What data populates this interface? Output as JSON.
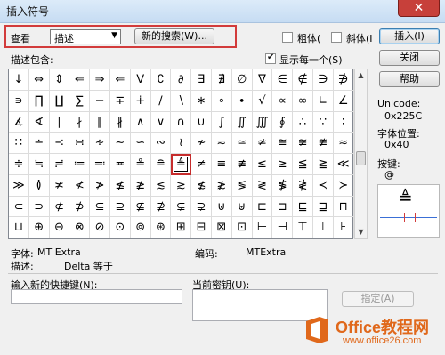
{
  "window": {
    "title": "插入符号",
    "close_glyph": "✕"
  },
  "toolbar": {
    "view_label": "查看",
    "view_value": "描述",
    "new_search_button": "新的搜索(W)...",
    "bold_label": "粗体(",
    "italic_label": "斜体(I",
    "insert_button": "插入(I)"
  },
  "list": {
    "description_label": "描述包含:",
    "show_each_label": "显示每一个(S)",
    "show_each_checked": true,
    "close_button": "关闭",
    "help_button": "帮助"
  },
  "symbols": [
    "↓",
    "⇔",
    "⇕",
    "⇐",
    "⇒",
    "⇐",
    "∀",
    "∁",
    "∂",
    "∃",
    "∄",
    "∅",
    "∇",
    "∈",
    "∉",
    "∋",
    "∌",
    "∍",
    "∏",
    "∐",
    "∑",
    "−",
    "∓",
    "∔",
    "∕",
    "∖",
    "∗",
    "∘",
    "∙",
    "√",
    "∝",
    "∞",
    "∟",
    "∠",
    "∡",
    "∢",
    "∣",
    "∤",
    "∥",
    "∦",
    "∧",
    "∨",
    "∩",
    "∪",
    "∫",
    "∬",
    "∭",
    "∮",
    "∴",
    "∵",
    "∶",
    "∷",
    "∸",
    "∹",
    "∺",
    "∻",
    "∼",
    "∽",
    "∾",
    "≀",
    "≁",
    "≂",
    "≃",
    "≄",
    "≅",
    "≆",
    "≇",
    "≈",
    "≑",
    "≒",
    "≓",
    "≔",
    "≕",
    "≖",
    "≗",
    "≘",
    "≜",
    "≠",
    "≡",
    "≢",
    "≤",
    "≥",
    "≦",
    "≧",
    "≪",
    "≫",
    "≬",
    "≭",
    "≮",
    "≯",
    "≰",
    "≱",
    "≲",
    "≳",
    "≴",
    "≵",
    "≶",
    "≷",
    "≸",
    "≹",
    "≺",
    "≻",
    "⊂",
    "⊃",
    "⊄",
    "⊅",
    "⊆",
    "⊇",
    "⊈",
    "⊉",
    "⊊",
    "⊋",
    "⊍",
    "⊎",
    "⊏",
    "⊐",
    "⊑",
    "⊒",
    "⊓",
    "⊔",
    "⊕",
    "⊖",
    "⊗",
    "⊘",
    "⊙",
    "⊚",
    "⊛",
    "⊞",
    "⊟",
    "⊠",
    "⊡",
    "⊢",
    "⊣",
    "⊤",
    "⊥",
    "⊦"
  ],
  "selected_index": 76,
  "info": {
    "unicode_label": "Unicode:",
    "unicode_value": "0x225C",
    "font_pos_label": "字体位置:",
    "font_pos_value": "0x40",
    "key_label": "按键:",
    "key_value": "@",
    "preview_symbol": "≜"
  },
  "details": {
    "font_label": "字体:",
    "font_value": "MT Extra",
    "encoding_label": "编码:",
    "encoding_value": "MTExtra",
    "desc_label": "描述:",
    "desc_value": "Delta 等于"
  },
  "shortcut": {
    "new_shortcut_label": "输入新的快捷键(N):",
    "current_key_label": "当前密钥(U):",
    "assign_button": "指定(A)"
  },
  "watermark": {
    "logo_color": "#e0681b",
    "text": "Office教程网",
    "url": "www.office26.com"
  }
}
